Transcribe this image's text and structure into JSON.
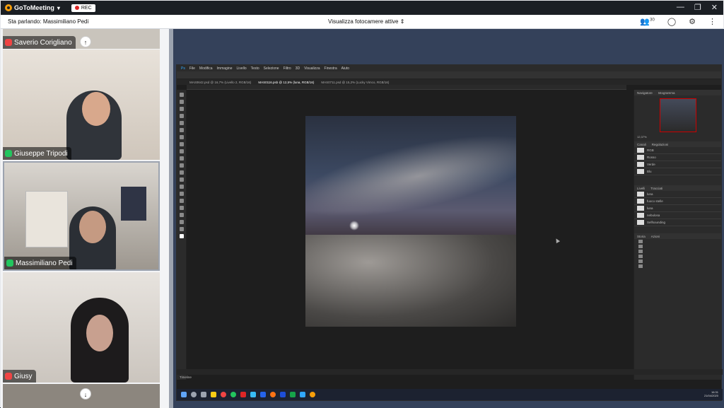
{
  "app": {
    "brand": "GoToMeeting",
    "rec_label": "REC",
    "speaking_text": "Sta parlando: Massimiliano Pedi",
    "camera_selector": "Visualizza fotocamere attive",
    "attendees_count": "30"
  },
  "participants": [
    {
      "name": "Saverio Corigliano",
      "mic": "muted"
    },
    {
      "name": "Giuseppe Tripodi",
      "mic": "active"
    },
    {
      "name": "Massimiliano Pedi",
      "mic": "active"
    },
    {
      "name": "Giusy",
      "mic": "muted"
    }
  ],
  "photoshop": {
    "menu": [
      "File",
      "Modifica",
      "Immagine",
      "Livello",
      "Testo",
      "Selezione",
      "Filtro",
      "3D",
      "Visualizza",
      "Finestra",
      "Aiuto"
    ],
    "tabs": [
      "MAS0642.psd @ 16,7% (Livello 2, RGB/16)",
      "MAS0116.psb @ 12,5% (luna, RGB/16)",
      "MAS0711.psd @ 15,2% (Lucky Vimco, RGB/16)"
    ],
    "panels": {
      "navigator_tabs": [
        "Navigatore",
        "Istogramma"
      ],
      "channels_tabs": [
        "Canali",
        "Regolazioni"
      ],
      "layers_tabs": [
        "Livelli",
        "Tracciati"
      ],
      "history_tabs": [
        "Storia",
        "Azioni"
      ],
      "channels": [
        "RGB",
        "Rosso",
        "Verde",
        "Blu"
      ],
      "layers": [
        "luna",
        "fuoco stelle",
        "luna",
        "nebulosa",
        "Selfsounding"
      ]
    },
    "timeline_label": "Timeline",
    "zoom": "12,37%"
  },
  "taskbar": {
    "time": "16:31",
    "date": "21/04/2020"
  },
  "colors": {
    "titlebar": "#1b1f24",
    "rec_dot": "#dc2626",
    "mic_muted": "#ef4444",
    "mic_active": "#22c55e",
    "screen_bg": "#34415a"
  }
}
